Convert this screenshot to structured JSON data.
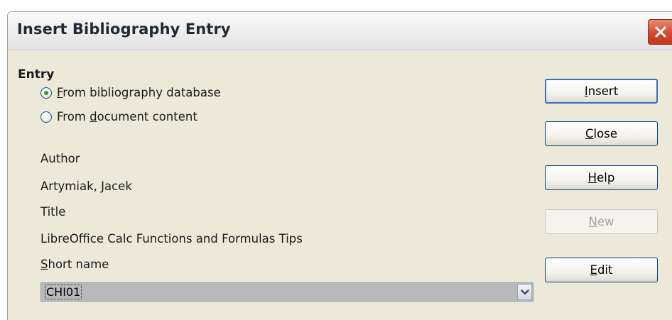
{
  "dialog": {
    "title": "Insert Bibliography Entry"
  },
  "entry": {
    "group_label": "Entry",
    "options": [
      {
        "label_key": "F",
        "label_rest": "rom bibliography database",
        "selected": true
      },
      {
        "label_pre": "From ",
        "label_key": "d",
        "label_rest": "ocument content",
        "selected": false
      }
    ]
  },
  "fields": {
    "author_label": "Author",
    "author_value": "Artymiak, Jacek",
    "title_label": "Title",
    "title_value": "LibreOffice Calc Functions and Formulas Tips",
    "short_name_key": "S",
    "short_name_rest": "hort name",
    "short_name_value": "CHI01"
  },
  "buttons": {
    "insert": {
      "key": "I",
      "rest": "nsert"
    },
    "close": {
      "key": "C",
      "rest": "lose"
    },
    "help": {
      "key": "H",
      "rest": "elp"
    },
    "new": {
      "key": "N",
      "rest": "ew"
    },
    "edit": {
      "key": "E",
      "rest": "dit"
    }
  },
  "icons": {
    "close": "close-x-icon",
    "dropdown": "chevron-down-icon"
  },
  "colors": {
    "close_button": "#d2462d",
    "radio_dot": "#2e9a2a",
    "focus_border": "#3b6fc3"
  }
}
